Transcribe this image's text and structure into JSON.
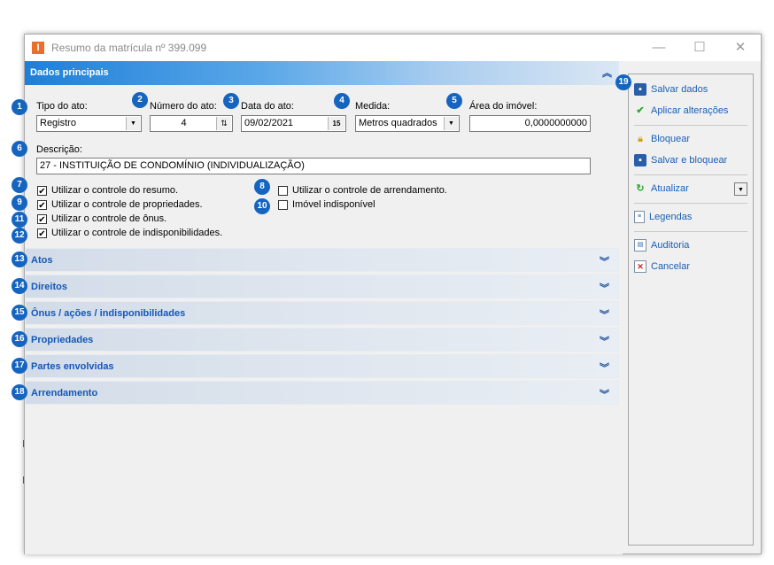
{
  "window": {
    "title": "Resumo da matrícula nº 399.099",
    "app_icon": "I",
    "minimize": "—",
    "maximize": "☐",
    "close": "✕"
  },
  "section_main": {
    "title": "Dados principais"
  },
  "fields": {
    "tipo_label": "Tipo do ato:",
    "tipo_value": "Registro",
    "numero_label": "Número do ato:",
    "numero_value": "4",
    "data_label": "Data do ato:",
    "data_value": "09/02/2021",
    "calendar_glyph": "15",
    "medida_label": "Medida:",
    "medida_value": "Metros quadrados",
    "area_label": "Área do imóvel:",
    "area_value": "0,0000000000",
    "descricao_label": "Descrição:",
    "descricao_value": "27 - INSTITUIÇÃO DE CONDOMÍNIO (INDIVIDUALIZAÇÃO)"
  },
  "checkboxes": {
    "resumo": {
      "label": "Utilizar o controle do resumo.",
      "checked": true
    },
    "propriedades": {
      "label": "Utilizar o controle de propriedades.",
      "checked": true
    },
    "onus": {
      "label": "Utilizar o controle de ônus.",
      "checked": true
    },
    "indisponibilidades": {
      "label": "Utilizar o controle de indisponibilidades.",
      "checked": true
    },
    "arrendamento": {
      "label": "Utilizar o controle de arrendamento.",
      "checked": false
    },
    "imovel_indisponivel": {
      "label": "Imóvel indisponível",
      "checked": false
    }
  },
  "sections": [
    "Atos",
    "Direitos",
    "Ônus / ações / indisponibilidades",
    "Propriedades",
    "Partes envolvidas",
    "Arrendamento"
  ],
  "actions": {
    "salvar_dados": "Salvar dados",
    "aplicar": "Aplicar alterações",
    "bloquear": "Bloquear",
    "salvar_bloquear": "Salvar e bloquear",
    "atualizar": "Atualizar",
    "legendas": "Legendas",
    "auditoria": "Auditoria",
    "cancelar": "Cancelar"
  },
  "badges": [
    "1",
    "2",
    "3",
    "4",
    "5",
    "6",
    "7",
    "8",
    "9",
    "10",
    "11",
    "12",
    "13",
    "14",
    "15",
    "16",
    "17",
    "18",
    "19"
  ],
  "colors": {
    "accent": "#1e7fd8",
    "badge": "#1565c0",
    "link": "#1a5fb4",
    "section_title": "#1357b8"
  }
}
